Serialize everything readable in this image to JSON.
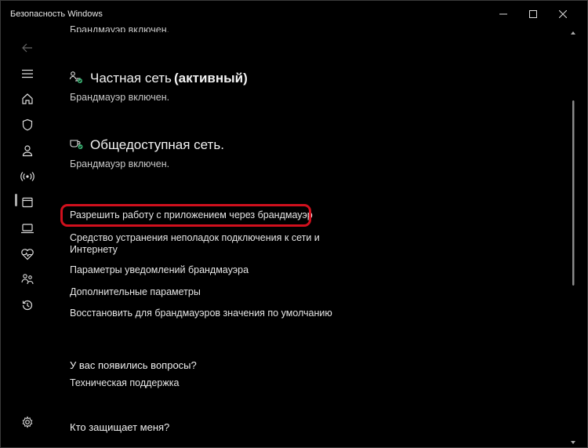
{
  "window": {
    "title": "Безопасность Windows"
  },
  "top_cut_text": "Брандмауэр включен.",
  "networks": [
    {
      "name": "Частная сеть",
      "badge": "(активный)",
      "status": "Брандмауэр включен.",
      "icon": "private-network-icon"
    },
    {
      "name": "Общедоступная сеть.",
      "status": "Брандмауэр включен.",
      "icon": "public-network-icon"
    }
  ],
  "links": [
    {
      "label": "Разрешить работу с приложением через брандмауэр"
    },
    {
      "label_line1": "Средство устранения неполадок подключения к сети и",
      "label_line2": "Интернету"
    },
    {
      "label": "Параметры уведомлений брандмауэра"
    },
    {
      "label": "Дополнительные параметры"
    },
    {
      "label": "Восстановить для брандмауэров значения по умолчанию"
    }
  ],
  "questions": {
    "heading": "У вас появились вопросы?",
    "support_link": "Техническая поддержка"
  },
  "who_protects": {
    "heading": "Кто защищает меня?"
  },
  "sidebar": {
    "items": [
      "back-arrow-icon",
      "hamburger-menu-icon",
      "home-icon",
      "shield-icon",
      "account-icon",
      "network-icon",
      "app-browser-icon",
      "device-icon",
      "health-icon",
      "family-icon",
      "history-icon",
      "settings-icon"
    ],
    "selected": "network-icon"
  },
  "colors": {
    "background": "#000000",
    "highlight": "#d0101d",
    "status_green": "#3bb273"
  }
}
